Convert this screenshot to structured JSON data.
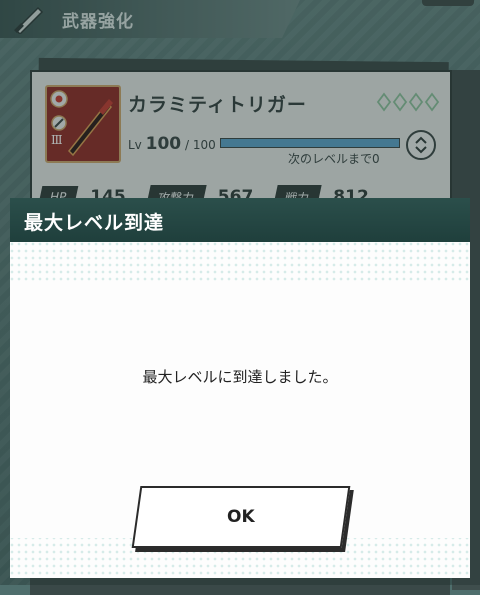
{
  "header": {
    "title": "武器強化"
  },
  "weapon": {
    "name": "カラミティトリガー",
    "lv_prefix": "Lv",
    "lv_current": "100",
    "lv_sep": "/",
    "lv_max": "100",
    "exp_fraction": 1.0,
    "next_label": "次のレベルまで0",
    "rank": "Ⅲ"
  },
  "stats": [
    {
      "label": "HP",
      "value": "145"
    },
    {
      "label": "攻撃力",
      "value": "567"
    },
    {
      "label": "戦力",
      "value": "812"
    }
  ],
  "dialog": {
    "title": "最大レベル到達",
    "message": "最大レベルに到達しました。",
    "ok_label": "OK"
  },
  "colors": {
    "header": "#2b4f4b",
    "weapon_frame": "#8e2a26",
    "exp_bar": "#5aa0c8"
  }
}
